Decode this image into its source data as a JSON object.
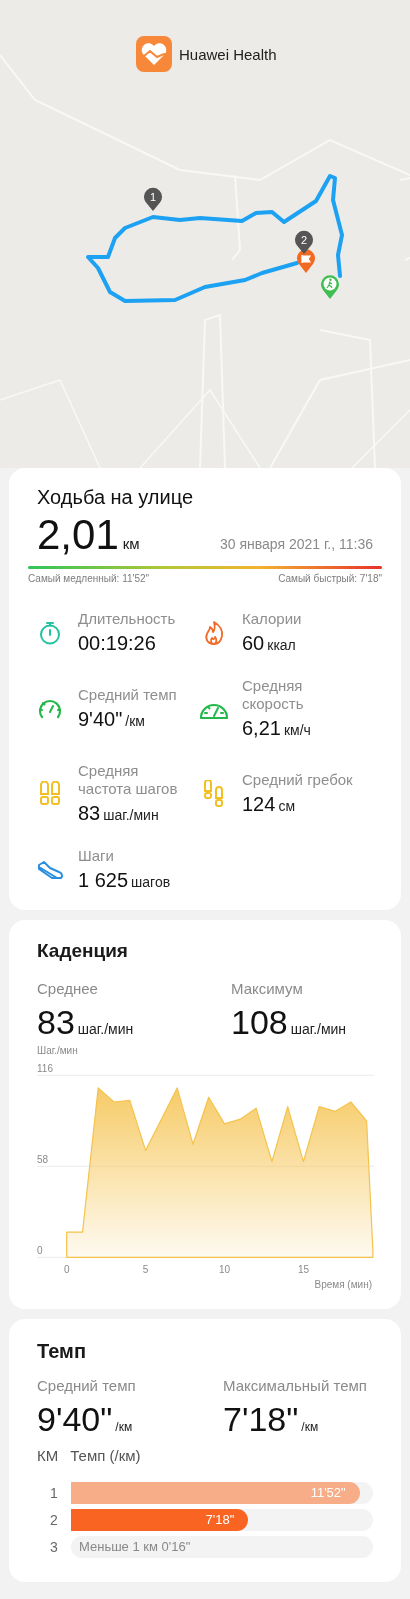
{
  "header": {
    "app_name": "Huawei Health"
  },
  "map": {
    "kind": "picture",
    "km_markers": [
      {
        "label": "1"
      },
      {
        "label": "2"
      }
    ]
  },
  "summary": {
    "title": "Ходьба на улице",
    "distance": "2,01",
    "distance_unit": "км",
    "date": "30 января 2021 г., 11:36",
    "slowest": "Самый медленный: 11'52\"",
    "fastest": "Самый быстрый: 7'18\""
  },
  "metrics": [
    {
      "label": "Длительность",
      "value": "00:19:26"
    },
    {
      "label": "Калории",
      "value": "60",
      "unit": "ккал"
    },
    {
      "label": "Средний темп",
      "value": "9'40\"",
      "unit": "/км"
    },
    {
      "label": "Средняя скорость",
      "value": "6,21",
      "unit": "км/ч"
    },
    {
      "label": "Средняя частота шагов",
      "value": "83",
      "unit": "шаг./мин"
    },
    {
      "label": "Средний гребок",
      "value": "124",
      "unit": "см"
    },
    {
      "label": "Шаги",
      "value": "1 625",
      "unit": "шагов"
    }
  ],
  "cadence": {
    "title": "Каденция",
    "stats": [
      {
        "label": "Среднее",
        "value": "83",
        "unit": "шаг./мин"
      },
      {
        "label": "Максимум",
        "value": "108",
        "unit": "шаг./мин"
      }
    ],
    "chart_data": {
      "type": "area",
      "ylabel": "Шаг./мин",
      "xlabel": "Время (мин)",
      "x": [
        0,
        1,
        2,
        3,
        4,
        5,
        6,
        7,
        8,
        9,
        10,
        11,
        12,
        13,
        14,
        15,
        16,
        17,
        18,
        19,
        19.4
      ],
      "series": [
        {
          "color": "#f5c24c",
          "values": [
            16,
            16,
            108,
            99,
            100,
            68,
            88,
            108,
            72,
            102,
            85,
            88,
            95,
            61,
            96,
            61,
            96,
            93,
            99,
            87,
            4
          ]
        }
      ],
      "xlim": [
        -1.88,
        19.47
      ],
      "ylim": [
        0,
        116
      ],
      "yticks": [
        0,
        58,
        116
      ],
      "xticks": [
        0,
        5,
        10,
        15
      ]
    }
  },
  "pace": {
    "title": "Темп",
    "stats": [
      {
        "label": "Средний темп",
        "value": "9'40\"",
        "unit": "/км"
      },
      {
        "label": "Максимальный темп",
        "value": "7'18\"",
        "unit": "/км"
      }
    ],
    "columns": [
      "КМ",
      "Темп (/км)"
    ],
    "splits": [
      {
        "km": "1",
        "kind": "bar",
        "level": 0.956,
        "color": "#f6ad88",
        "time": "11'52\""
      },
      {
        "km": "2",
        "kind": "bar",
        "level": 0.587,
        "color": "#fa6422",
        "time": "7'18\""
      },
      {
        "km": "3",
        "kind": "note",
        "text": "Меньше 1 км 0'16\""
      }
    ]
  }
}
